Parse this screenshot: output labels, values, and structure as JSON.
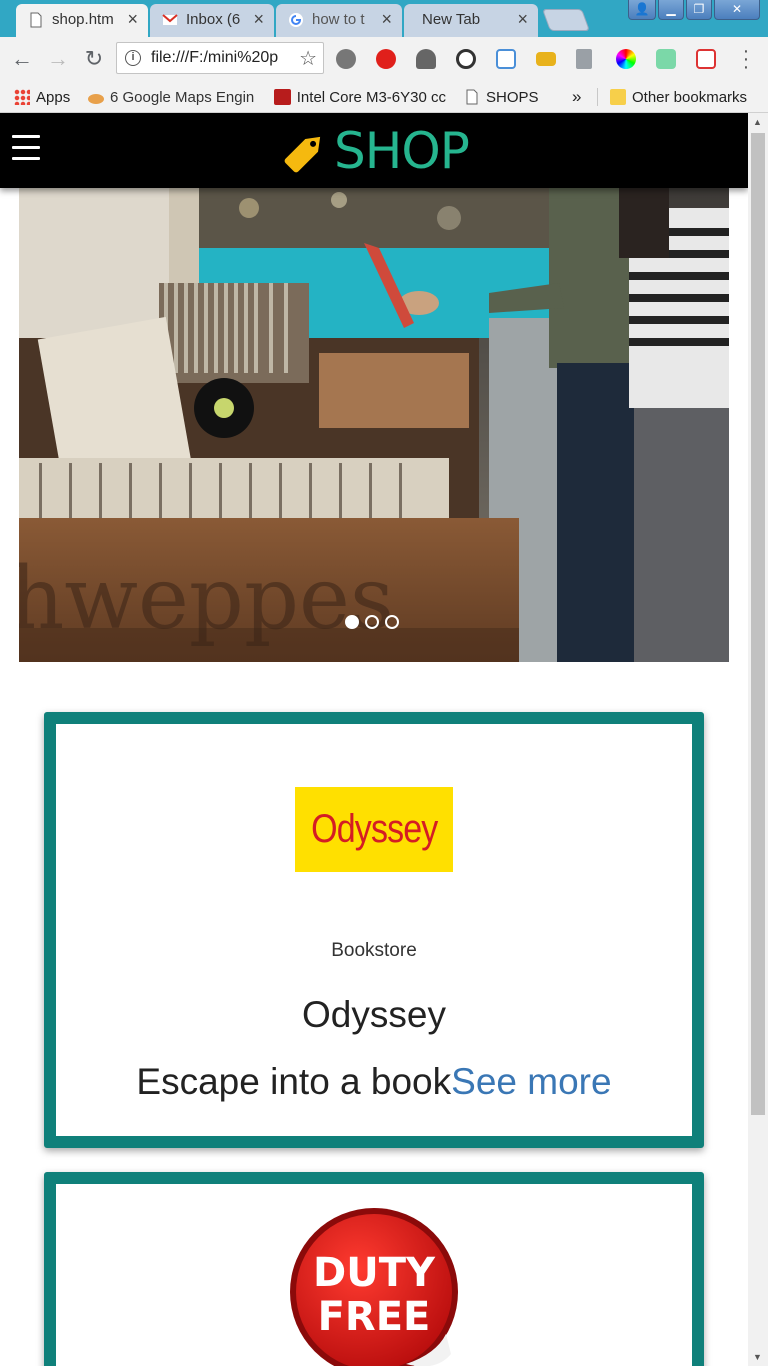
{
  "browser": {
    "tabs": [
      {
        "title": "shop.htm",
        "active": true
      },
      {
        "title": "Inbox (6",
        "active": false
      },
      {
        "title": "how to t",
        "active": false
      },
      {
        "title": "New Tab",
        "active": false
      }
    ],
    "url": "file:///F:/mini%20p",
    "bookmarks": [
      {
        "label": "Apps"
      },
      {
        "label": "6 Google Maps Engin"
      },
      {
        "label": "Intel Core M3-6Y30 cc"
      },
      {
        "label": "SHOPS"
      }
    ],
    "overflow_label": "»",
    "other_bookmarks": "Other bookmarks"
  },
  "header": {
    "brand": "SHOP",
    "brand_color": "#26b58f"
  },
  "carousel": {
    "slide_count": 3,
    "active_index": 0
  },
  "cards": [
    {
      "logo_text": "Odyssey",
      "category": "Bookstore",
      "name": "Odyssey",
      "tagline": "Escape into a book",
      "link": "See more"
    },
    {
      "logo_line1": "DUTY",
      "logo_line2": "FREE"
    }
  ],
  "colors": {
    "card_border": "#0f807a",
    "link": "#3a77b5",
    "header_bg": "#000000"
  }
}
